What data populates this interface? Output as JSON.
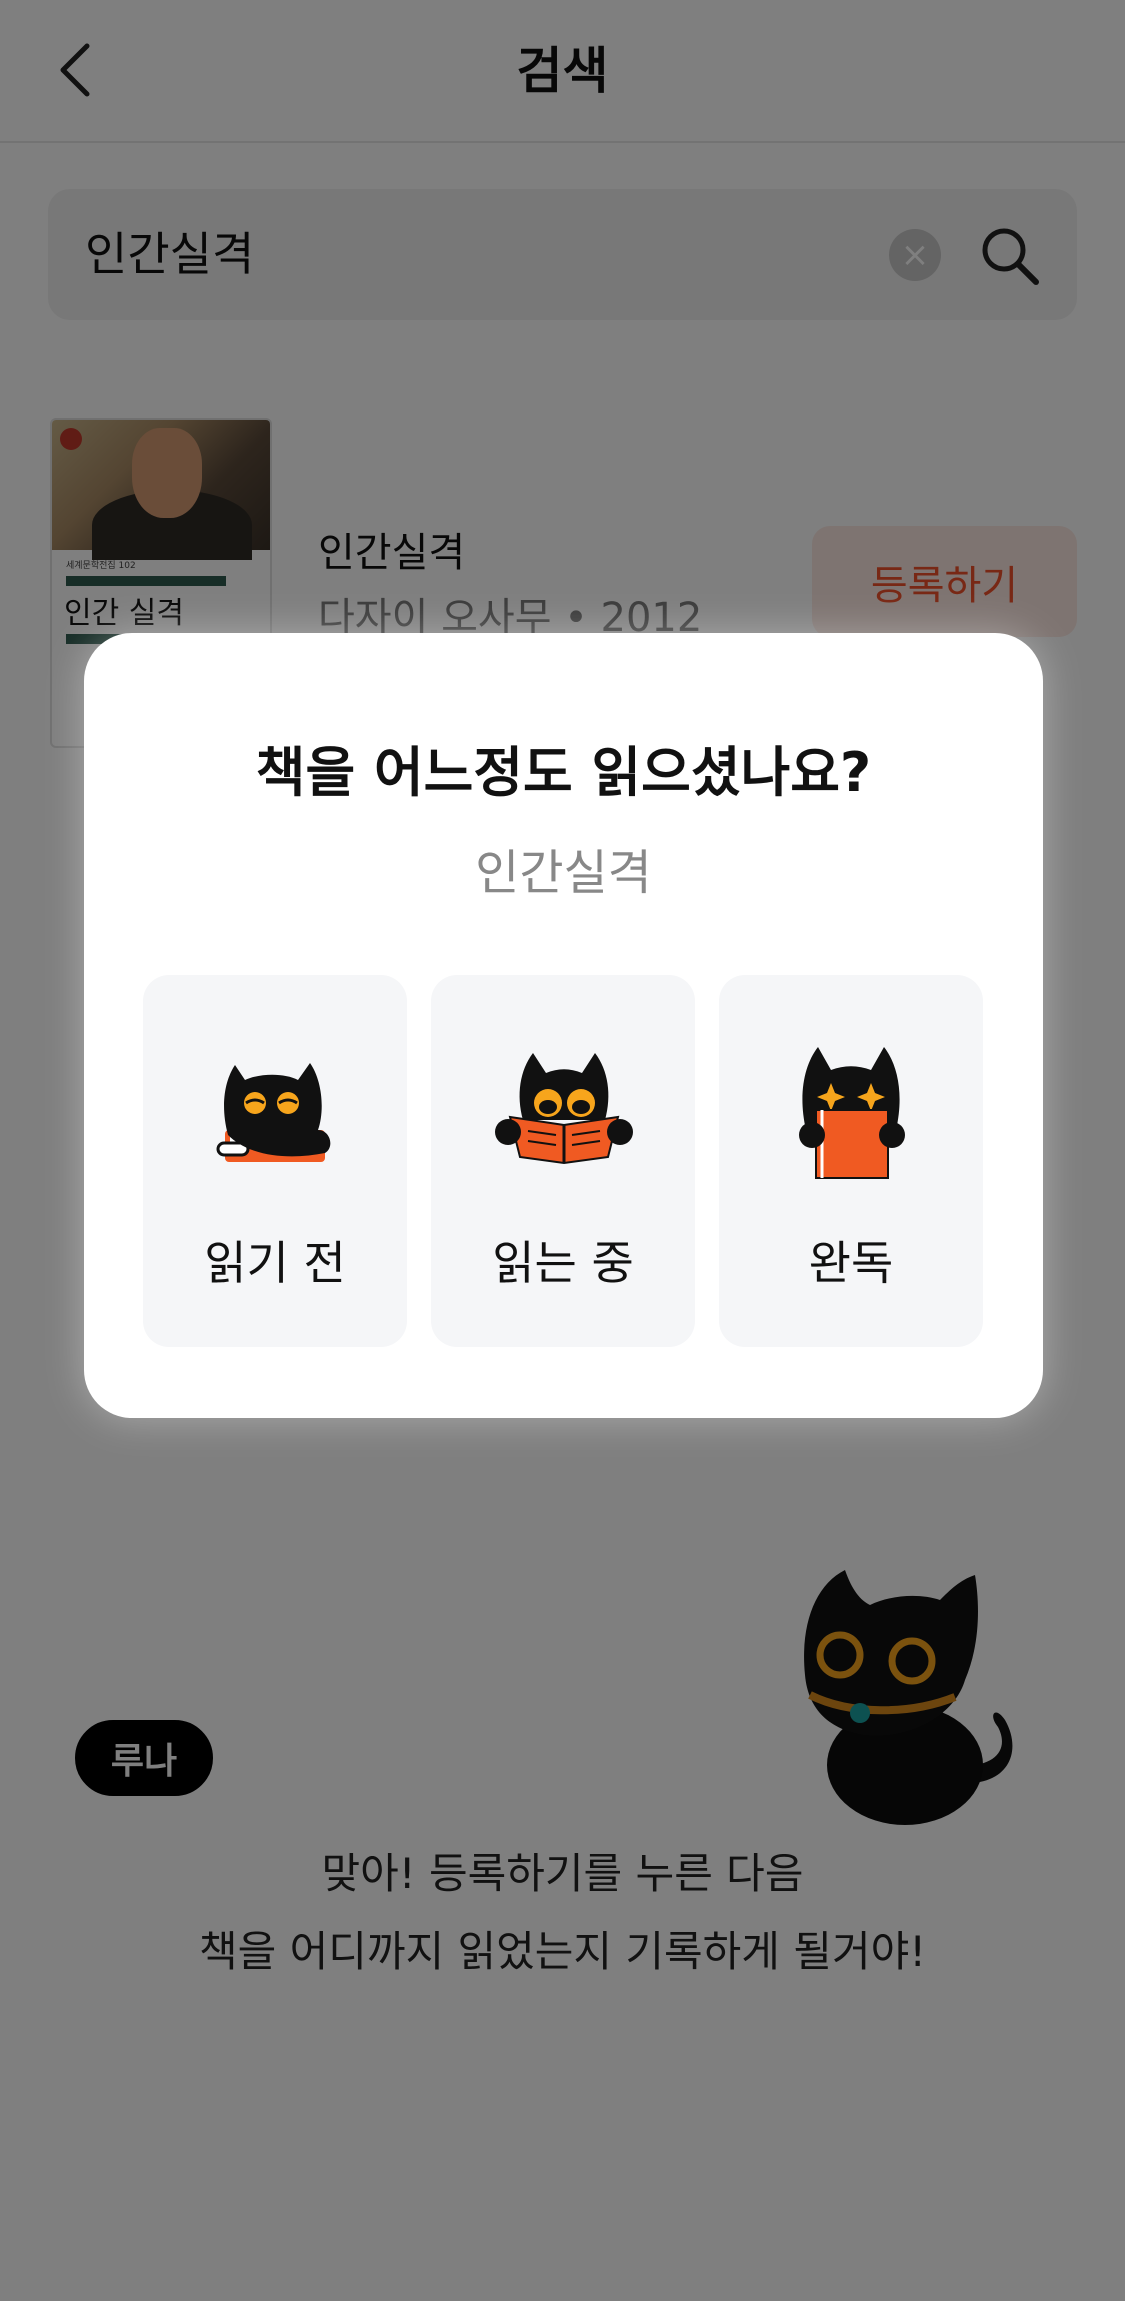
{
  "header": {
    "title": "검색"
  },
  "search": {
    "query": "인간실격"
  },
  "result": {
    "cover": {
      "series": "세계문학전집 102",
      "title": "인간 실격"
    },
    "title": "인간실격",
    "meta": "다자이 오사무 • 2012",
    "register_label": "등록하기"
  },
  "modal": {
    "question": "책을 어느정도 읽으셨나요?",
    "book_title": "인간실격",
    "options": [
      {
        "label": "읽기 전",
        "icon": "cat-sleeping-on-book-icon"
      },
      {
        "label": "읽는 중",
        "icon": "cat-reading-open-book-icon"
      },
      {
        "label": "완독",
        "icon": "cat-holding-closed-book-icon"
      }
    ]
  },
  "guide": {
    "speaker": "루나",
    "line1": "맞아! 등록하기를 누른 다음",
    "line2": "책을 어디까지 읽었는지 기록하게 될거야!"
  },
  "colors": {
    "accent": "#F0502A",
    "cat_eye": "#F7A51C",
    "overlay": "rgba(0,0,0,0.5)"
  }
}
